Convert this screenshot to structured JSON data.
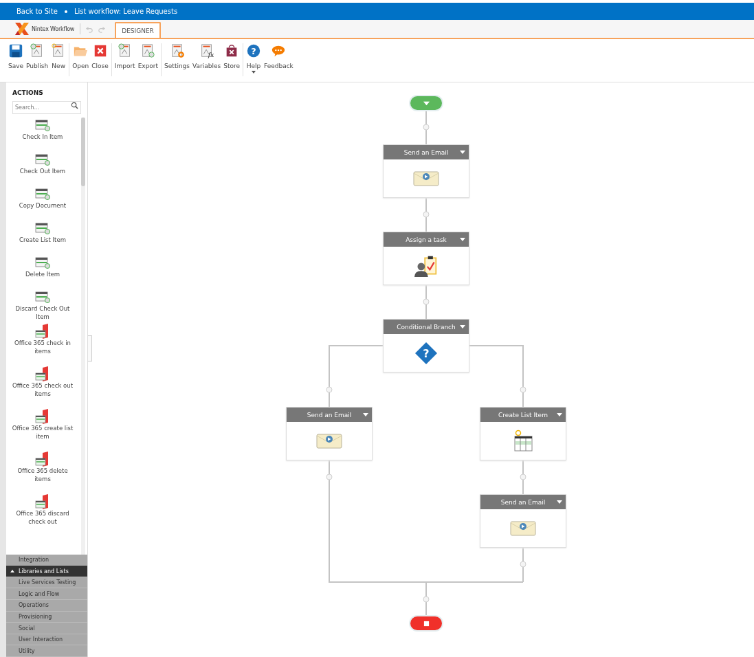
{
  "breadcrumb": [
    "Back to Site",
    "List workflow: Leave Requests"
  ],
  "brand": {
    "name": "Nintex Workflow"
  },
  "history_buttons": [
    {
      "kind": "undo",
      "disabled": true
    },
    {
      "kind": "redo",
      "disabled": true
    }
  ],
  "tabs": [
    {
      "label": "DESIGNER",
      "selected": true
    }
  ],
  "ribbon": [
    [
      {
        "kind": "save",
        "label": "Save"
      },
      {
        "kind": "publish",
        "label": "Publish"
      },
      {
        "kind": "new",
        "label": "New"
      }
    ],
    [
      {
        "kind": "open",
        "label": "Open"
      },
      {
        "kind": "close",
        "label": "Close"
      }
    ],
    [
      {
        "kind": "import",
        "label": "Import"
      },
      {
        "kind": "export",
        "label": "Export"
      }
    ],
    [
      {
        "kind": "settings",
        "label": "Settings"
      },
      {
        "kind": "variables",
        "label": "Variables",
        "glyph": "fx"
      },
      {
        "kind": "store",
        "label": "Store"
      }
    ],
    [
      {
        "kind": "help",
        "label": "Help",
        "glyph": "?",
        "dropdown": true
      },
      {
        "kind": "feedback",
        "label": "Feedback"
      }
    ]
  ],
  "sidebar": {
    "title": "ACTIONS",
    "search": {
      "placeholder": "Search..."
    },
    "items": [
      {
        "label": "Check In Item",
        "kind": "list"
      },
      {
        "label": "Check Out Item",
        "kind": "list"
      },
      {
        "label": "Copy Document",
        "kind": "list"
      },
      {
        "label": "Create List Item",
        "kind": "list"
      },
      {
        "label": "Delete Item",
        "kind": "list"
      },
      {
        "label": "Discard Check Out Item",
        "kind": "list"
      },
      {
        "label": "Office 365 check in items",
        "kind": "office"
      },
      {
        "label": "Office 365 check out items",
        "kind": "office"
      },
      {
        "label": "Office 365 create list item",
        "kind": "office"
      },
      {
        "label": "Office 365 delete items",
        "kind": "office"
      },
      {
        "label": "Office 365 discard check out",
        "kind": "office"
      }
    ],
    "categories": [
      {
        "label": "Integration",
        "expanded": false
      },
      {
        "label": "Libraries and Lists",
        "expanded": true
      },
      {
        "label": "Live Services Testing",
        "expanded": false
      },
      {
        "label": "Logic and Flow",
        "expanded": false
      },
      {
        "label": "Operations",
        "expanded": false
      },
      {
        "label": "Provisioning",
        "expanded": false
      },
      {
        "label": "Social",
        "expanded": false
      },
      {
        "label": "User Interaction",
        "expanded": false
      },
      {
        "label": "Utility",
        "expanded": false
      }
    ]
  },
  "workflow": {
    "nodes": [
      {
        "title": "Send an Email",
        "kind": "email"
      },
      {
        "title": "Assign a task",
        "kind": "task"
      },
      {
        "title": "Conditional Branch",
        "kind": "branch",
        "glyph": "?"
      },
      {
        "title": "Send an Email",
        "kind": "email"
      },
      {
        "title": "Create List Item",
        "kind": "create-list"
      },
      {
        "title": "Send an Email",
        "kind": "email"
      }
    ]
  }
}
